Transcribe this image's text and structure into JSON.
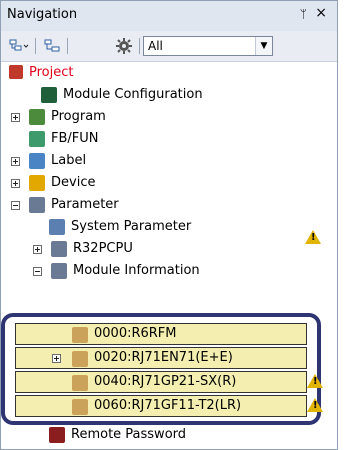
{
  "panel": {
    "title": "Navigation",
    "pin_glyph": "ᛘ",
    "close_glyph": "×"
  },
  "toolbar": {
    "filter_value": "All",
    "buttons": [
      "tree-layout-icon",
      "expand-icon",
      "gear-icon"
    ]
  },
  "tree": {
    "project": "Project",
    "module_configuration": "Module Configuration",
    "program": "Program",
    "fb_fun": "FB/FUN",
    "label": "Label",
    "device": "Device",
    "parameter": "Parameter",
    "system_parameter": "System Parameter",
    "cpu": "R32PCPU",
    "module_information": "Module Information",
    "remote_password": "Remote Password"
  },
  "modules": [
    {
      "label": "0000:R6RFM"
    },
    {
      "label": "0020:RJ71EN71(E+E)"
    },
    {
      "label": "0040:RJ71GP21-SX(R)"
    },
    {
      "label": "0060:RJ71GF11-T2(LR)"
    }
  ],
  "colors": {
    "project_text": "#e0001b",
    "highlight_bg": "#f4efb1",
    "overlay_border": "#2f3573",
    "warning": "#e0b400"
  }
}
